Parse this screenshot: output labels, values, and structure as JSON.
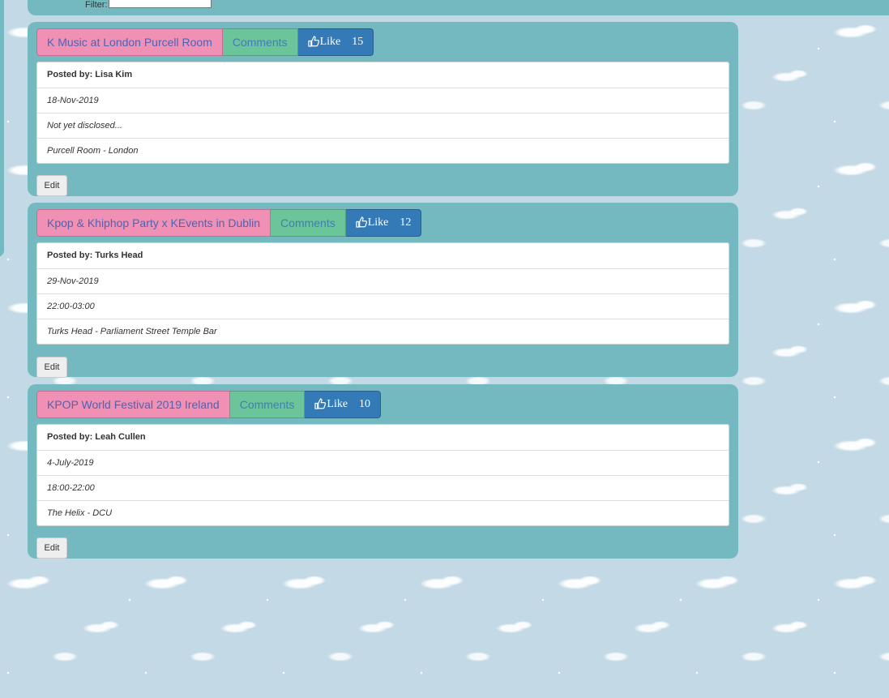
{
  "filter": {
    "label": "Filter:",
    "value": ""
  },
  "events": [
    {
      "title": "K Music at London Purcell Room",
      "comments_label": "Comments",
      "like_label": "Like",
      "like_count": "15",
      "posted_by_label": "Posted by:",
      "posted_by": "Lisa Kim",
      "date": "18-Nov-2019",
      "time": "Not yet disclosed...",
      "location": "Purcell Room - London",
      "edit_label": "Edit"
    },
    {
      "title": "Kpop & Khiphop Party x KEvents in Dublin",
      "comments_label": "Comments",
      "like_label": "Like",
      "like_count": "12",
      "posted_by_label": "Posted by:",
      "posted_by": "Turks Head",
      "date": "29-Nov-2019",
      "time": "22:00-03:00",
      "location": "Turks Head - Parliament Street Temple Bar",
      "edit_label": "Edit"
    },
    {
      "title": "KPOP World Festival 2019 Ireland",
      "comments_label": "Comments",
      "like_label": "Like",
      "like_count": "10",
      "posted_by_label": "Posted by:",
      "posted_by": "Leah Cullen",
      "date": "4-July-2019",
      "time": "18:00-22:00",
      "location": "The Helix - DCU",
      "edit_label": "Edit"
    }
  ],
  "colors": {
    "background": "#c3dae6",
    "card": "#75b9c0",
    "title_button": "#f090b4",
    "comments_button": "#6cc49a",
    "like_button": "#347ab7"
  },
  "icons": {
    "like": "thumbs-up-icon"
  }
}
